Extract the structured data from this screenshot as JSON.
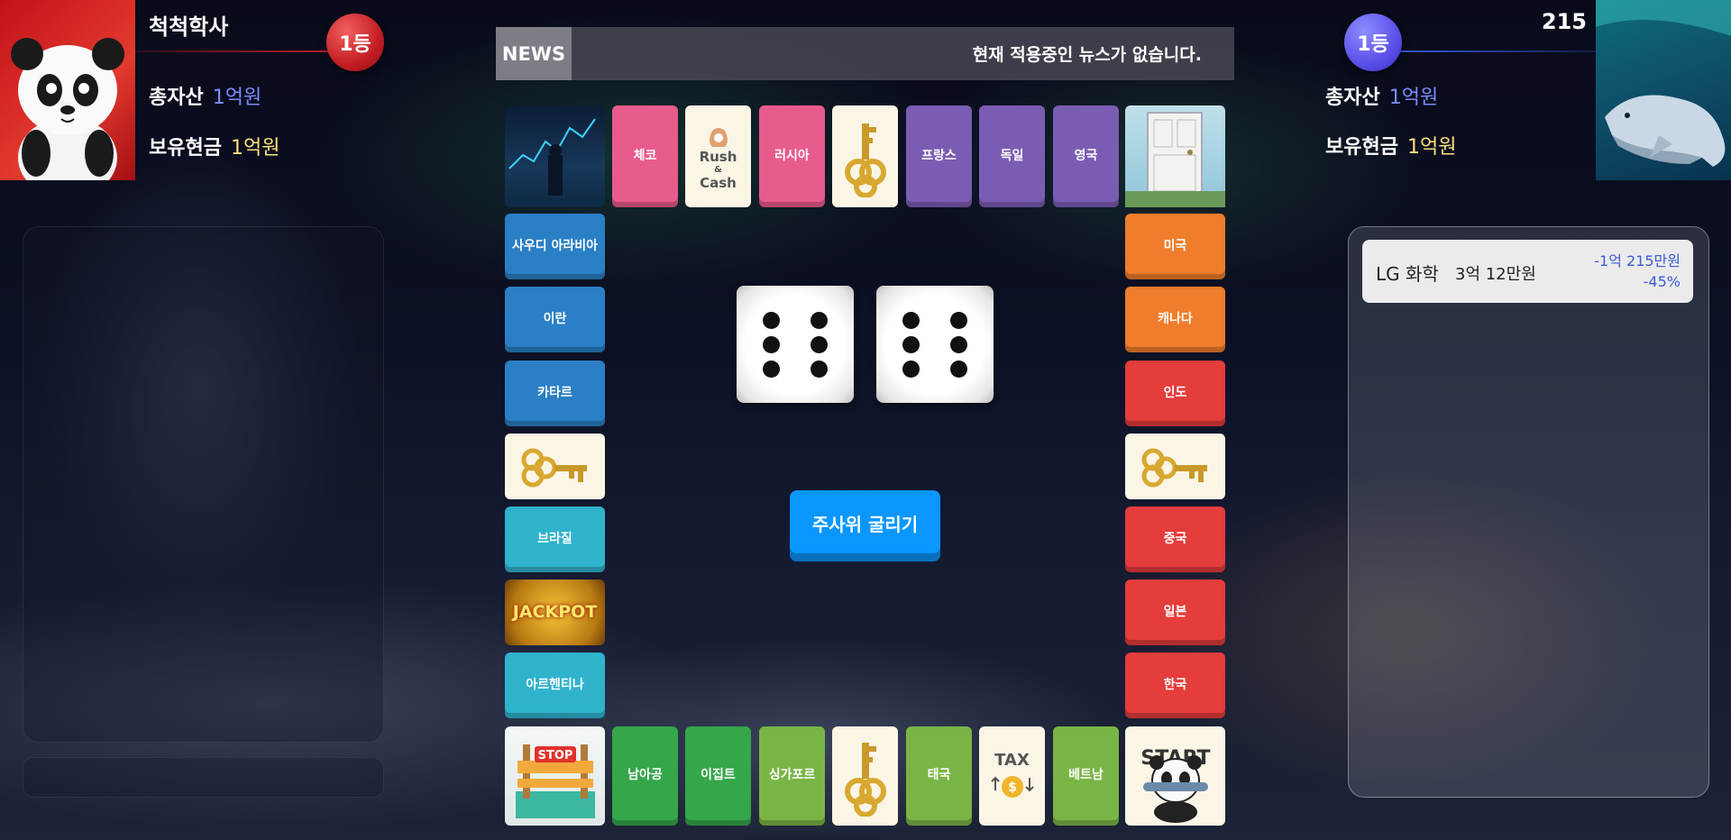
{
  "left_player": {
    "name": "척척학사",
    "rank": "1등",
    "total_assets_label": "총자산",
    "total_assets_value": "1억원",
    "cash_label": "보유현금",
    "cash_value": "1억원",
    "avatar_icon": "panda-avatar"
  },
  "right_player": {
    "score": "215",
    "rank": "1등",
    "total_assets_label": "총자산",
    "total_assets_value": "1억원",
    "cash_label": "보유현금",
    "cash_value": "1억원",
    "avatar_icon": "whale-avatar"
  },
  "news": {
    "label": "NEWS",
    "text": "현재 적용중인 뉴스가 없습니다."
  },
  "board": {
    "top": [
      "체코",
      "Rush & Cash",
      "러시아",
      "key-card",
      "프랑스",
      "독일",
      "영국"
    ],
    "left": [
      "사우디 아라비아",
      "이란",
      "카타르",
      "key-card",
      "브라질",
      "JACKPOT",
      "아르헨티나"
    ],
    "right": [
      "미국",
      "캐나다",
      "인도",
      "key-card",
      "중국",
      "일본",
      "한국"
    ],
    "bottom": [
      "남아공",
      "이집트",
      "싱가포르",
      "key-card",
      "태국",
      "TAX",
      "베트남"
    ],
    "rush_cash": [
      "Rush",
      "&",
      "Cash"
    ],
    "tax": "TAX",
    "stop": "STOP",
    "jackpot": "JACKPOT",
    "start_text": "START"
  },
  "dice": [
    6,
    6
  ],
  "roll_button_label": "주사위 굴리기",
  "holding": {
    "name": "LG 화학",
    "amount": "3억 12만원",
    "change": "-1억 215만원",
    "percent": "-45%"
  },
  "colors": {
    "pink": "#e85b8d",
    "purple": "#7b5cb3",
    "blue": "#2a7fc5",
    "teal": "#2fb3cd",
    "green": "#35a64a",
    "lime": "#79b545",
    "orange": "#f07d2b",
    "red": "#e53c3c",
    "asset_value": "#7b8cff",
    "cash_value": "#ffe27a",
    "loss": "#3b5bdb"
  }
}
